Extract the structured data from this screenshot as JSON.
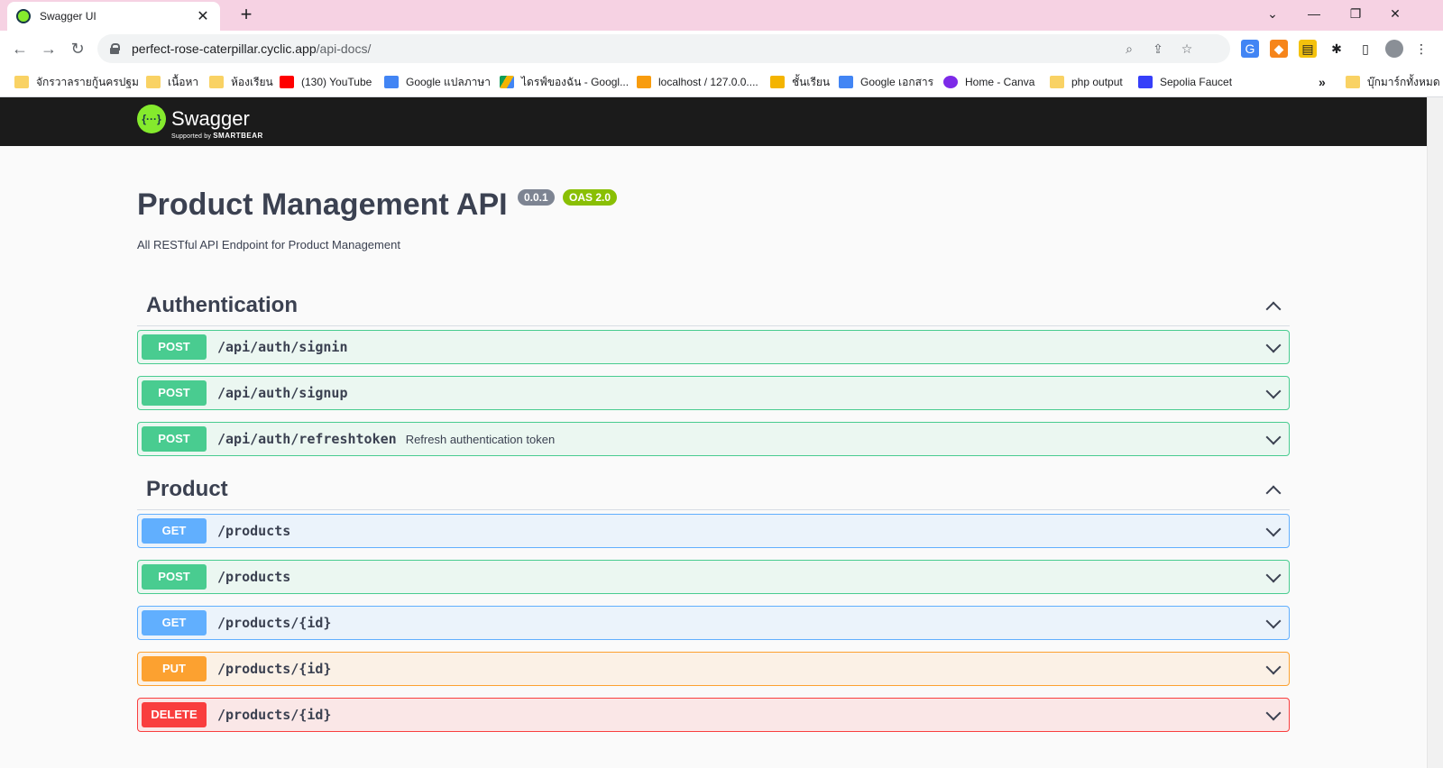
{
  "browser": {
    "tab_title": "Swagger UI",
    "url_host": "perfect-rose-caterpillar.cyclic.app",
    "url_path": "/api-docs/",
    "bookmarks": [
      {
        "label": "จักรวาลรายกู้นครปฐม",
        "icon": "folder-icon"
      },
      {
        "label": "เนื้อหา",
        "icon": "folder-icon"
      },
      {
        "label": "ห้องเรียน",
        "icon": "folder-icon"
      },
      {
        "label": "(130) YouTube",
        "icon": "youtube-icon"
      },
      {
        "label": "Google แปลภาษา",
        "icon": "google-translate-icon"
      },
      {
        "label": "ไดรฟ์ของฉัน - Googl...",
        "icon": "google-drive-icon"
      },
      {
        "label": "localhost / 127.0.0....",
        "icon": "phpmyadmin-icon"
      },
      {
        "label": "ชั้นเรียน",
        "icon": "classroom-icon"
      },
      {
        "label": "Google เอกสาร",
        "icon": "google-docs-icon"
      },
      {
        "label": "Home - Canva",
        "icon": "canva-icon"
      },
      {
        "label": "php output",
        "icon": "folder-icon"
      },
      {
        "label": "Sepolia Faucet",
        "icon": "alchemy-icon"
      }
    ],
    "overflow_label": "»",
    "all_bookmarks": "บุ๊กมาร์กทั้งหมด"
  },
  "swagger": {
    "brand": "Swagger",
    "supported_by": "Supported by",
    "smartbear": "SMARTBEAR"
  },
  "info": {
    "title": "Product Management API",
    "version": "0.0.1",
    "oas": "OAS 2.0",
    "description": "All RESTful API Endpoint for Product Management"
  },
  "sections": [
    {
      "name": "Authentication",
      "operations": [
        {
          "method": "POST",
          "path": "/api/auth/signin",
          "summary": ""
        },
        {
          "method": "POST",
          "path": "/api/auth/signup",
          "summary": ""
        },
        {
          "method": "POST",
          "path": "/api/auth/refreshtoken",
          "summary": "Refresh authentication token"
        }
      ]
    },
    {
      "name": "Product",
      "operations": [
        {
          "method": "GET",
          "path": "/products",
          "summary": ""
        },
        {
          "method": "POST",
          "path": "/products",
          "summary": ""
        },
        {
          "method": "GET",
          "path": "/products/{id}",
          "summary": ""
        },
        {
          "method": "PUT",
          "path": "/products/{id}",
          "summary": ""
        },
        {
          "method": "DELETE",
          "path": "/products/{id}",
          "summary": ""
        }
      ]
    }
  ],
  "colors": {
    "post": "#49cc90",
    "get": "#61affe",
    "put": "#fca130",
    "delete": "#f93e3e",
    "topbar": "#1b1b1b",
    "tabstrip": "#f6d2e3"
  }
}
